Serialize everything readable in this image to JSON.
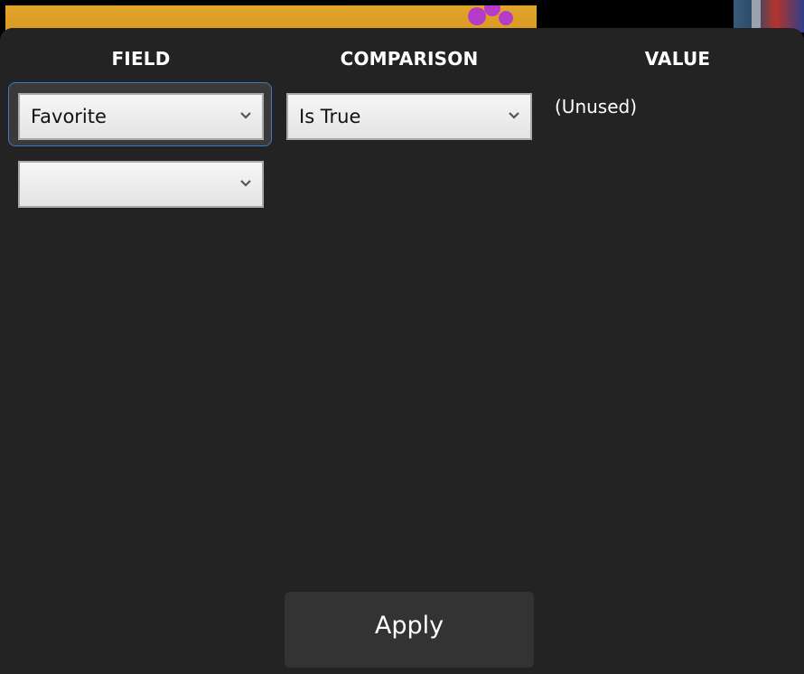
{
  "filter_dialog": {
    "headers": {
      "field": "FIELD",
      "comparison": "COMPARISON",
      "value": "VALUE"
    },
    "rows": [
      {
        "field_selected": "Favorite",
        "comparison_selected": "Is True",
        "value_text": "(Unused)"
      },
      {
        "field_selected": ""
      }
    ],
    "apply_label": "Apply"
  },
  "colors": {
    "panel_background": "#232323",
    "focus_ring": "#3b7bc4",
    "select_background": "#eeeeee",
    "select_border": "#a9a9a9",
    "button_background": "#333333",
    "text_primary": "#ffffff"
  },
  "icons": {
    "dropdown": "chevron-down-icon"
  }
}
